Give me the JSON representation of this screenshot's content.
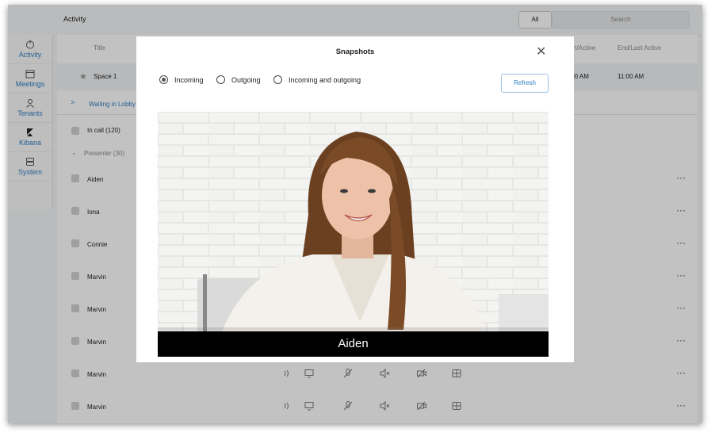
{
  "header": {
    "title": "Activity",
    "tab_all": "All",
    "search_placeholder": "Search"
  },
  "sidebar": {
    "items": [
      {
        "label": "Activity",
        "icon": "power-icon"
      },
      {
        "label": "Meetings",
        "icon": "calendar-icon"
      },
      {
        "label": "Tenants",
        "icon": "user-icon"
      },
      {
        "label": "Kibana",
        "icon": "kibana-icon"
      },
      {
        "label": "System",
        "icon": "server-icon"
      }
    ]
  },
  "table": {
    "columns": {
      "title": "Title",
      "start_active": "art/Active",
      "end_last_active": "End/Last Active"
    },
    "space_row": {
      "name": "Space 1",
      "start": ":00 AM",
      "end": "11:00 AM"
    },
    "lobby_label": "Waiting in Lobby",
    "incall_label": "In call (120)",
    "presenter_label": "Presenter (30)",
    "participants": [
      "Aiden",
      "Iona",
      "Connie",
      "Marvin",
      "Marvin",
      "Marvin",
      "Marvin",
      "Marvin"
    ],
    "more_label": "···"
  },
  "modal": {
    "title": "Snapshots",
    "close": "✕",
    "options": [
      "Incoming",
      "Outgoing",
      "Incoming and outgoing"
    ],
    "selected_option": "Incoming",
    "refresh_label": "Refresh",
    "snapshot_caption": "Aiden"
  },
  "colors": {
    "accent": "#2f7fc4",
    "overlay": "#000000"
  }
}
